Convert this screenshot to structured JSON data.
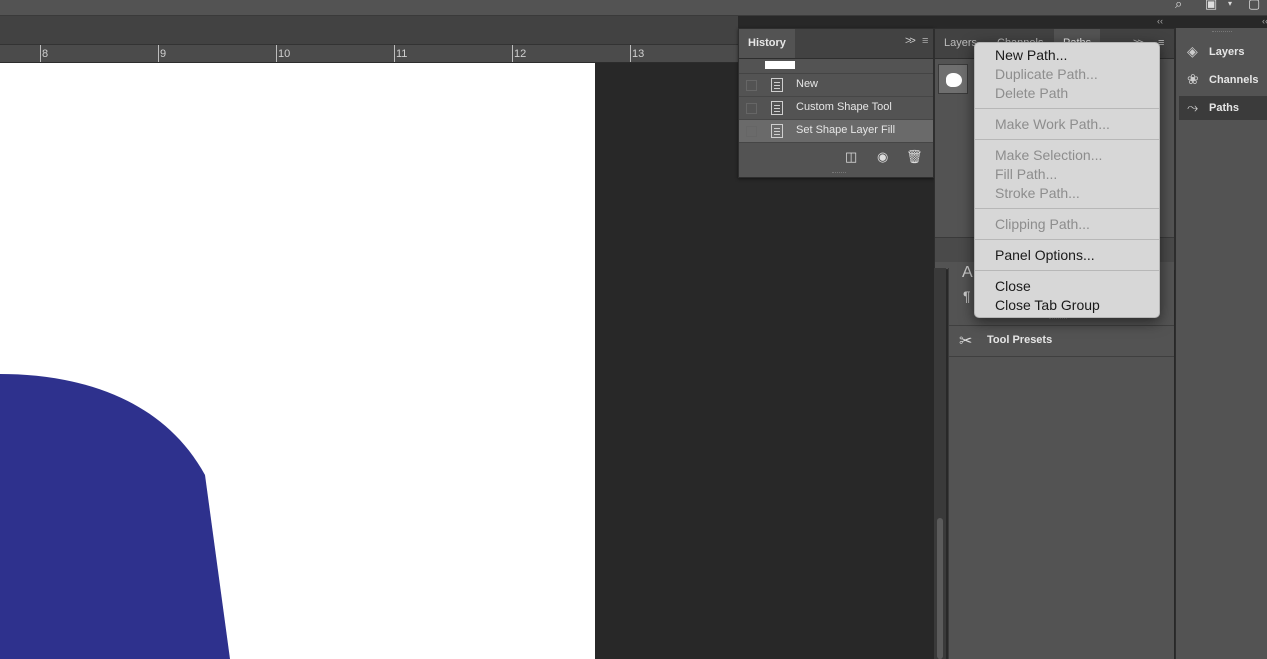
{
  "ruler": {
    "marks": [
      "8",
      "9",
      "10",
      "11",
      "12",
      "13"
    ]
  },
  "history": {
    "tab_label": "History",
    "items": [
      {
        "label": "New"
      },
      {
        "label": "Custom Shape Tool"
      },
      {
        "label": "Set Shape Layer Fill"
      }
    ],
    "selected_index": 2
  },
  "paths_panel": {
    "tabs": [
      "Layers",
      "Channels",
      "Paths"
    ],
    "active_tab": "Paths"
  },
  "context_menu": {
    "items": [
      {
        "label": "New Path...",
        "enabled": true
      },
      {
        "label": "Duplicate Path...",
        "enabled": false
      },
      {
        "label": "Delete Path",
        "enabled": false
      },
      {
        "label": "Make Work Path...",
        "enabled": false
      },
      {
        "label": "Make Selection...",
        "enabled": false
      },
      {
        "label": "Fill Path...",
        "enabled": false
      },
      {
        "label": "Stroke Path...",
        "enabled": false
      },
      {
        "label": "Clipping Path...",
        "enabled": false
      },
      {
        "label": "Panel Options...",
        "enabled": true
      },
      {
        "label": "Close",
        "enabled": true
      },
      {
        "label": "Close Tab Group",
        "enabled": true
      }
    ]
  },
  "mid_panel": {
    "tool_presets_label": "Tool Presets"
  },
  "dock": {
    "items": [
      {
        "label": "Layers",
        "icon": "layers-icon"
      },
      {
        "label": "Channels",
        "icon": "channels-icon"
      },
      {
        "label": "Paths",
        "icon": "paths-icon"
      }
    ],
    "selected": "Paths"
  },
  "colors": {
    "shape_fill": "#2e318d",
    "canvas": "#ffffff",
    "workspace": "#282828"
  }
}
